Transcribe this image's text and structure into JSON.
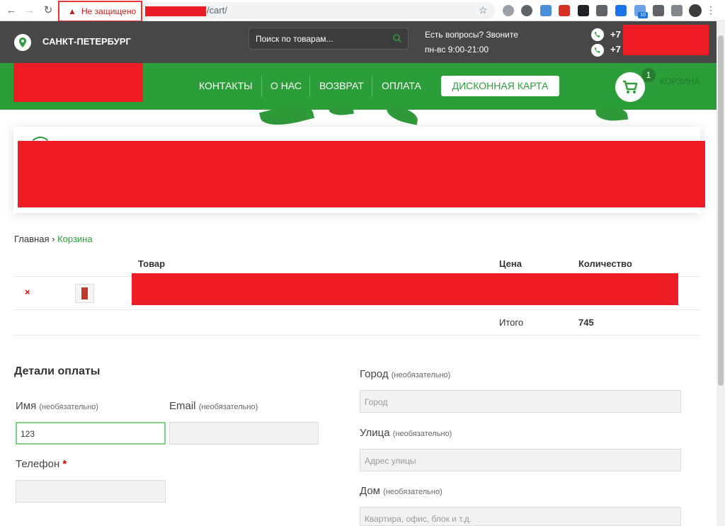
{
  "browser": {
    "security_label": "Не защищено",
    "url_path": "/cart/"
  },
  "header": {
    "city": "САНКТ-ПЕТЕРБУРГ",
    "search_placeholder": "Поиск по товарам...",
    "question": "Есть вопросы? Звоните",
    "hours": "пн-вс 9:00-21:00",
    "phones": [
      "+7",
      "+7"
    ]
  },
  "nav": {
    "items": [
      "КОНТАКТЫ",
      "О НАС",
      "ВОЗВРАТ",
      "ОПЛАТА"
    ],
    "discount_card": "ДИСКОННАЯ КАРТА",
    "cart_count": "1",
    "cart_label": "КОРЗИНА"
  },
  "breadcrumb": {
    "home": "Главная",
    "separator": "›",
    "current": "Корзина"
  },
  "cart": {
    "columns": [
      "Товар",
      "Цена",
      "Количество"
    ],
    "remove_symbol": "×",
    "total_label": "Итого",
    "total_value": "745"
  },
  "billing": {
    "title": "Детали оплаты",
    "name_label": "Имя",
    "name_value": "123",
    "email_label": "Email",
    "phone_label": "Телефон",
    "optional": "(необязательно)",
    "required_mark": "*",
    "city_label": "Город",
    "city_placeholder": "Город",
    "street_label": "Улица",
    "street_placeholder": "Адрес улицы",
    "house_label": "Дом",
    "house_placeholder": "Квартира, офис, блок и т.д."
  },
  "colors": {
    "brand_green": "#2b9e39",
    "topbar": "#474747",
    "redaction": "#ee1c25"
  }
}
